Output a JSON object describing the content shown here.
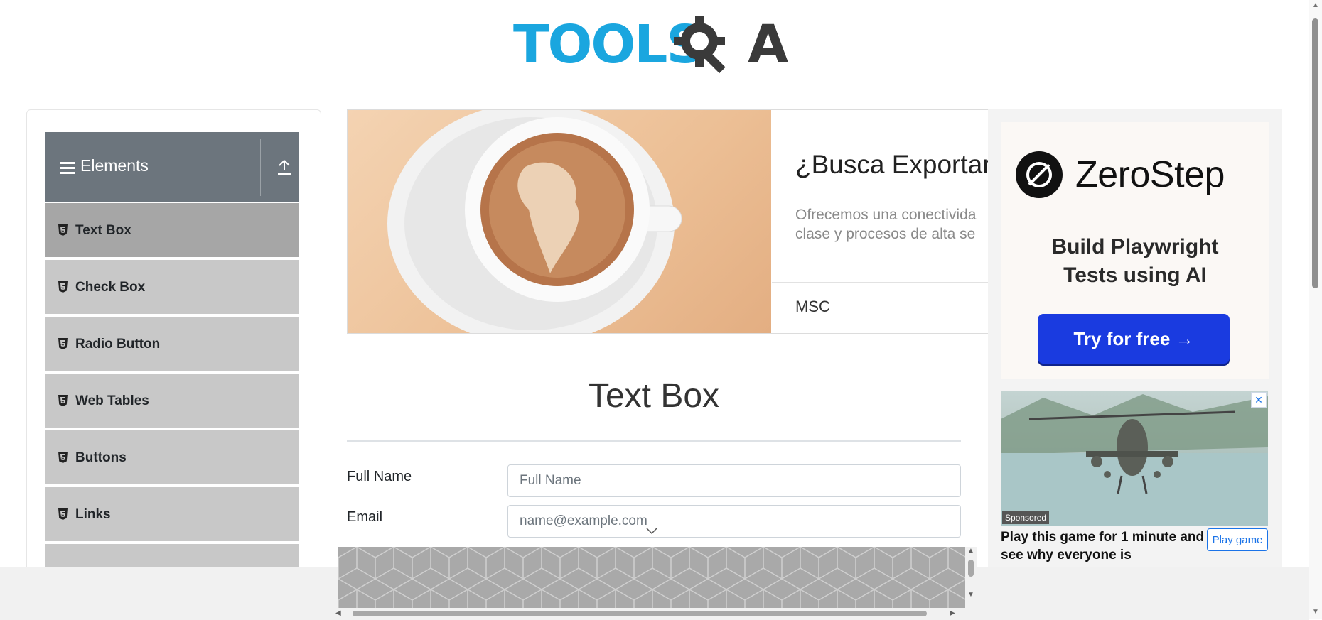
{
  "logo": {
    "text": "TOOLSQA"
  },
  "sidebar": {
    "group_title": "Elements",
    "items": [
      {
        "label": "Text Box",
        "active": true
      },
      {
        "label": "Check Box"
      },
      {
        "label": "Radio Button"
      },
      {
        "label": "Web Tables"
      },
      {
        "label": "Buttons"
      },
      {
        "label": "Links"
      }
    ]
  },
  "banner_ad": {
    "headline": "¿Busca Exportar",
    "description": "Ofrecemos una conectivida clase y procesos de alta se",
    "brand": "MSC"
  },
  "main": {
    "title": "Text Box",
    "full_name_label": "Full Name",
    "full_name_placeholder": "Full Name",
    "email_label": "Email",
    "email_placeholder": "name@example.com"
  },
  "right_ad": {
    "brand": "ZeroStep",
    "tagline_line1": "Build Playwright",
    "tagline_line2": "Tests using AI",
    "cta": "Try for free →",
    "close": "✕",
    "sponsored": "Sponsored",
    "game_text": "Play this game for 1 minute and see why everyone is",
    "play_button": "Play game",
    "accent": "#1a3be0"
  },
  "colors": {
    "header_bg": "#6c757d",
    "menu_bg": "#c8c8c8",
    "menu_active": "#a6a6a6",
    "logo_blue": "#1aa6df"
  }
}
